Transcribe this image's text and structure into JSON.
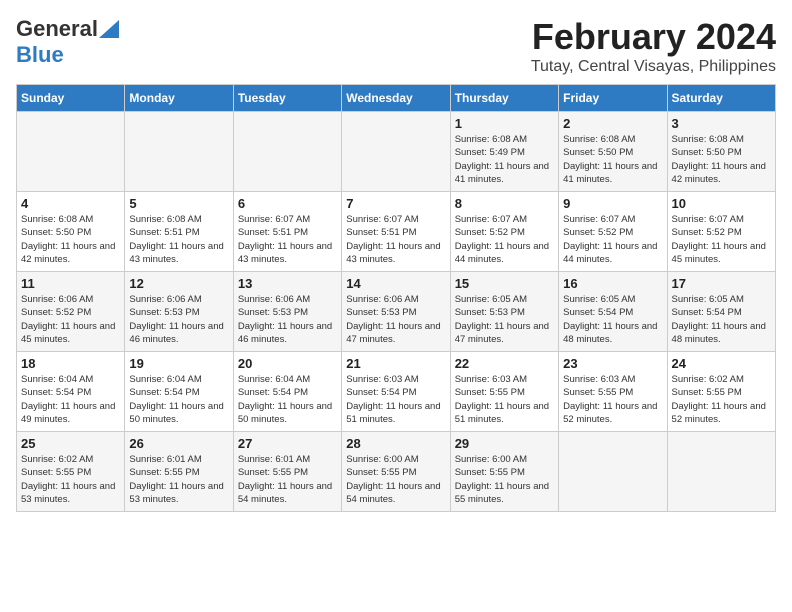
{
  "logo": {
    "line1": "General",
    "line2": "Blue"
  },
  "header": {
    "month": "February 2024",
    "location": "Tutay, Central Visayas, Philippines"
  },
  "weekdays": [
    "Sunday",
    "Monday",
    "Tuesday",
    "Wednesday",
    "Thursday",
    "Friday",
    "Saturday"
  ],
  "weeks": [
    [
      {
        "day": "",
        "sunrise": "",
        "sunset": "",
        "daylight": ""
      },
      {
        "day": "",
        "sunrise": "",
        "sunset": "",
        "daylight": ""
      },
      {
        "day": "",
        "sunrise": "",
        "sunset": "",
        "daylight": ""
      },
      {
        "day": "",
        "sunrise": "",
        "sunset": "",
        "daylight": ""
      },
      {
        "day": "1",
        "sunrise": "Sunrise: 6:08 AM",
        "sunset": "Sunset: 5:49 PM",
        "daylight": "Daylight: 11 hours and 41 minutes."
      },
      {
        "day": "2",
        "sunrise": "Sunrise: 6:08 AM",
        "sunset": "Sunset: 5:50 PM",
        "daylight": "Daylight: 11 hours and 41 minutes."
      },
      {
        "day": "3",
        "sunrise": "Sunrise: 6:08 AM",
        "sunset": "Sunset: 5:50 PM",
        "daylight": "Daylight: 11 hours and 42 minutes."
      }
    ],
    [
      {
        "day": "4",
        "sunrise": "Sunrise: 6:08 AM",
        "sunset": "Sunset: 5:50 PM",
        "daylight": "Daylight: 11 hours and 42 minutes."
      },
      {
        "day": "5",
        "sunrise": "Sunrise: 6:08 AM",
        "sunset": "Sunset: 5:51 PM",
        "daylight": "Daylight: 11 hours and 43 minutes."
      },
      {
        "day": "6",
        "sunrise": "Sunrise: 6:07 AM",
        "sunset": "Sunset: 5:51 PM",
        "daylight": "Daylight: 11 hours and 43 minutes."
      },
      {
        "day": "7",
        "sunrise": "Sunrise: 6:07 AM",
        "sunset": "Sunset: 5:51 PM",
        "daylight": "Daylight: 11 hours and 43 minutes."
      },
      {
        "day": "8",
        "sunrise": "Sunrise: 6:07 AM",
        "sunset": "Sunset: 5:52 PM",
        "daylight": "Daylight: 11 hours and 44 minutes."
      },
      {
        "day": "9",
        "sunrise": "Sunrise: 6:07 AM",
        "sunset": "Sunset: 5:52 PM",
        "daylight": "Daylight: 11 hours and 44 minutes."
      },
      {
        "day": "10",
        "sunrise": "Sunrise: 6:07 AM",
        "sunset": "Sunset: 5:52 PM",
        "daylight": "Daylight: 11 hours and 45 minutes."
      }
    ],
    [
      {
        "day": "11",
        "sunrise": "Sunrise: 6:06 AM",
        "sunset": "Sunset: 5:52 PM",
        "daylight": "Daylight: 11 hours and 45 minutes."
      },
      {
        "day": "12",
        "sunrise": "Sunrise: 6:06 AM",
        "sunset": "Sunset: 5:53 PM",
        "daylight": "Daylight: 11 hours and 46 minutes."
      },
      {
        "day": "13",
        "sunrise": "Sunrise: 6:06 AM",
        "sunset": "Sunset: 5:53 PM",
        "daylight": "Daylight: 11 hours and 46 minutes."
      },
      {
        "day": "14",
        "sunrise": "Sunrise: 6:06 AM",
        "sunset": "Sunset: 5:53 PM",
        "daylight": "Daylight: 11 hours and 47 minutes."
      },
      {
        "day": "15",
        "sunrise": "Sunrise: 6:05 AM",
        "sunset": "Sunset: 5:53 PM",
        "daylight": "Daylight: 11 hours and 47 minutes."
      },
      {
        "day": "16",
        "sunrise": "Sunrise: 6:05 AM",
        "sunset": "Sunset: 5:54 PM",
        "daylight": "Daylight: 11 hours and 48 minutes."
      },
      {
        "day": "17",
        "sunrise": "Sunrise: 6:05 AM",
        "sunset": "Sunset: 5:54 PM",
        "daylight": "Daylight: 11 hours and 48 minutes."
      }
    ],
    [
      {
        "day": "18",
        "sunrise": "Sunrise: 6:04 AM",
        "sunset": "Sunset: 5:54 PM",
        "daylight": "Daylight: 11 hours and 49 minutes."
      },
      {
        "day": "19",
        "sunrise": "Sunrise: 6:04 AM",
        "sunset": "Sunset: 5:54 PM",
        "daylight": "Daylight: 11 hours and 50 minutes."
      },
      {
        "day": "20",
        "sunrise": "Sunrise: 6:04 AM",
        "sunset": "Sunset: 5:54 PM",
        "daylight": "Daylight: 11 hours and 50 minutes."
      },
      {
        "day": "21",
        "sunrise": "Sunrise: 6:03 AM",
        "sunset": "Sunset: 5:54 PM",
        "daylight": "Daylight: 11 hours and 51 minutes."
      },
      {
        "day": "22",
        "sunrise": "Sunrise: 6:03 AM",
        "sunset": "Sunset: 5:55 PM",
        "daylight": "Daylight: 11 hours and 51 minutes."
      },
      {
        "day": "23",
        "sunrise": "Sunrise: 6:03 AM",
        "sunset": "Sunset: 5:55 PM",
        "daylight": "Daylight: 11 hours and 52 minutes."
      },
      {
        "day": "24",
        "sunrise": "Sunrise: 6:02 AM",
        "sunset": "Sunset: 5:55 PM",
        "daylight": "Daylight: 11 hours and 52 minutes."
      }
    ],
    [
      {
        "day": "25",
        "sunrise": "Sunrise: 6:02 AM",
        "sunset": "Sunset: 5:55 PM",
        "daylight": "Daylight: 11 hours and 53 minutes."
      },
      {
        "day": "26",
        "sunrise": "Sunrise: 6:01 AM",
        "sunset": "Sunset: 5:55 PM",
        "daylight": "Daylight: 11 hours and 53 minutes."
      },
      {
        "day": "27",
        "sunrise": "Sunrise: 6:01 AM",
        "sunset": "Sunset: 5:55 PM",
        "daylight": "Daylight: 11 hours and 54 minutes."
      },
      {
        "day": "28",
        "sunrise": "Sunrise: 6:00 AM",
        "sunset": "Sunset: 5:55 PM",
        "daylight": "Daylight: 11 hours and 54 minutes."
      },
      {
        "day": "29",
        "sunrise": "Sunrise: 6:00 AM",
        "sunset": "Sunset: 5:55 PM",
        "daylight": "Daylight: 11 hours and 55 minutes."
      },
      {
        "day": "",
        "sunrise": "",
        "sunset": "",
        "daylight": ""
      },
      {
        "day": "",
        "sunrise": "",
        "sunset": "",
        "daylight": ""
      }
    ]
  ]
}
